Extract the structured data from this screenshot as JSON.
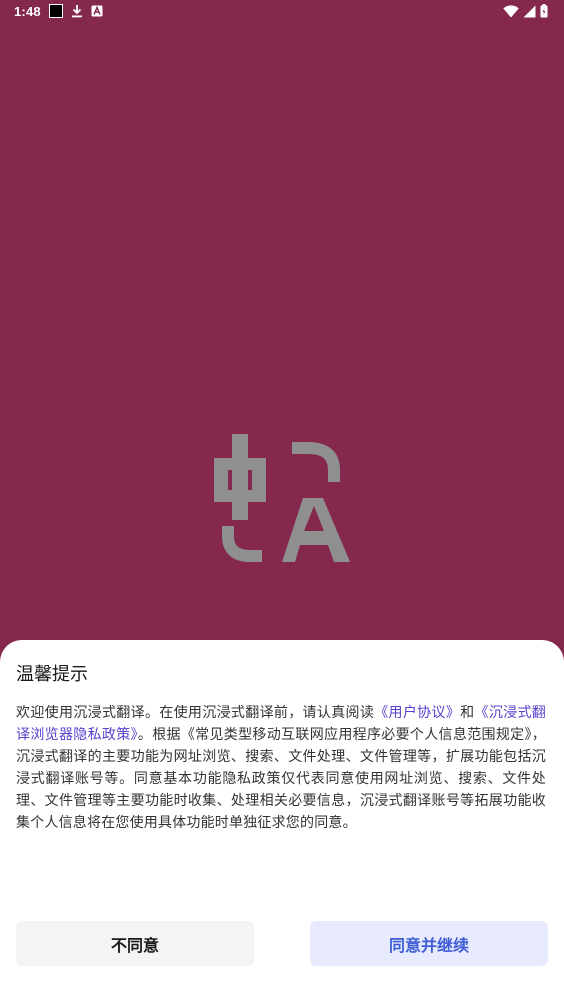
{
  "status_bar": {
    "time": "1:48",
    "left_icons": [
      "black-square-icon",
      "download-icon",
      "a-badge-icon"
    ],
    "right_icons": [
      "wifi-icon",
      "signal-icon",
      "battery-icon"
    ]
  },
  "splash": {
    "logo_chars": {
      "cn": "中",
      "latin": "A"
    },
    "background": "#84294d"
  },
  "dialog": {
    "title": "温馨提示",
    "body": {
      "p1": "欢迎使用沉浸式翻译。在使用沉浸式翻译前，请认真阅读",
      "link1": "《用户协议》",
      "p2": "和",
      "link2": "《沉浸式翻译浏览器隐私政策》",
      "p3": "。根据《常见类型移动互联网应用程序必要个人信息范围规定》，沉浸式翻译的主要功能为网址浏览、搜索、文件处理、文件管理等，扩展功能包括沉浸式翻译账号等。同意基本功能隐私政策仅代表同意使用网址浏览、搜索、文件处理、文件管理等主要功能时收集、处理相关必要信息，沉浸式翻译账号等拓展功能收集个人信息将在您使用具体功能时单独征求您的同意。"
    },
    "buttons": {
      "decline": "不同意",
      "accept": "同意并继续"
    },
    "colors": {
      "link": "#5a3fd0",
      "accept_text": "#3f5ed6",
      "accept_bg": "#e8ebfd",
      "decline_bg": "#f4f4f6"
    }
  }
}
